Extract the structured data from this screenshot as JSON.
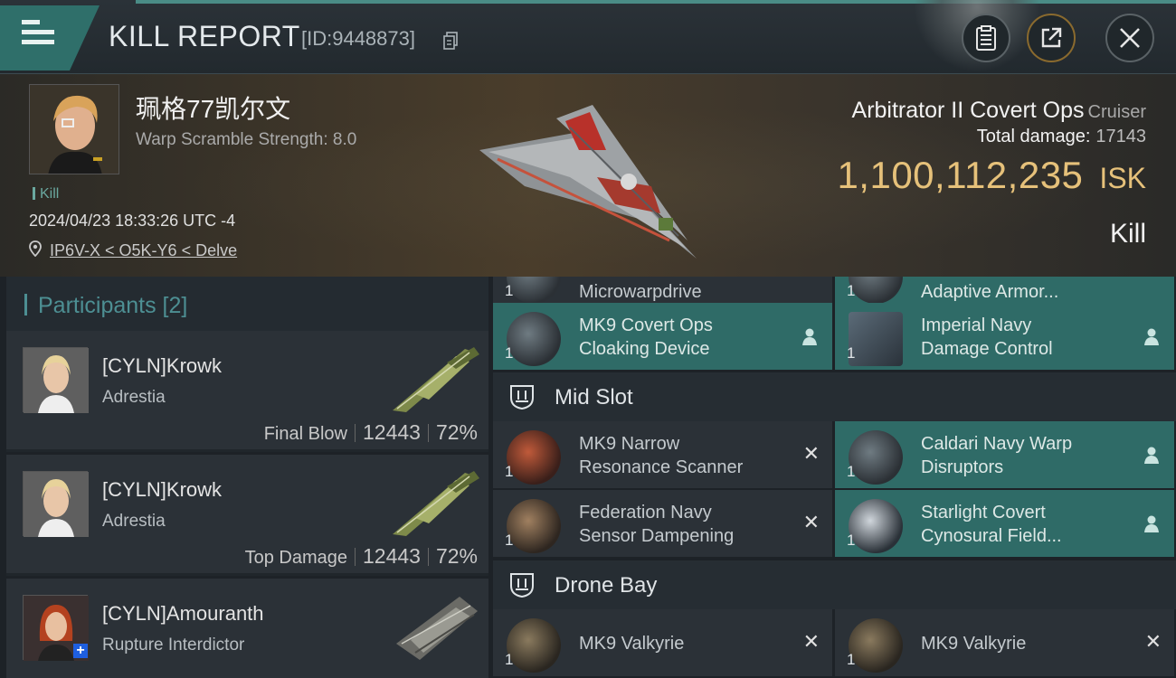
{
  "header": {
    "title": "KILL REPORT",
    "kill_id": "[ID:9448873]"
  },
  "icons": {
    "menu": "hamburger-menu-icon",
    "copy": "copy-icon",
    "report": "clipboard-icon",
    "share": "share-external-icon",
    "close": "close-icon"
  },
  "victim": {
    "name": "珮格77凯尔文",
    "scram": "Warp Scramble Strength: 8.0",
    "tag": "Kill",
    "time": "2024/04/23 18:33:26 UTC -4",
    "location": "IP6V-X < O5K-Y6 < Delve"
  },
  "ship": {
    "name": "Arbitrator II Covert Ops",
    "class": "Cruiser",
    "damage_label": "Total damage:",
    "damage_value": "17143",
    "isk_value": "1,100,112,235",
    "isk_unit": "ISK",
    "result": "Kill"
  },
  "participants": {
    "title": "Participants [2]",
    "items": [
      {
        "name": "[CYLN]Krowk",
        "ship": "Adrestia",
        "role": "Final Blow",
        "damage": "12443",
        "percent": "72%"
      },
      {
        "name": "[CYLN]Krowk",
        "ship": "Adrestia",
        "role": "Top Damage",
        "damage": "12443",
        "percent": "72%"
      },
      {
        "name": "[CYLN]Amouranth",
        "ship": "Rupture Interdictor"
      }
    ]
  },
  "fitting": {
    "top_partial": [
      {
        "label": "Microwarpdrive",
        "qty": "1"
      },
      {
        "label": "Adaptive Armor...",
        "qty": "1"
      }
    ],
    "low_slots": [
      {
        "label_line1": "MK9 Covert Ops",
        "label_line2": "Cloaking Device",
        "qty": "1"
      },
      {
        "label_line1": "Imperial Navy",
        "label_line2": "Damage Control",
        "qty": "1"
      }
    ],
    "mid_slot_title": "Mid Slot",
    "mid_slots": [
      {
        "label_line1": "MK9 Narrow",
        "label_line2": "Resonance Scanner",
        "qty": "1",
        "status": "destroyed"
      },
      {
        "label_line1": "Caldari Navy Warp",
        "label_line2": "Disruptors",
        "qty": "1",
        "status": "dropped"
      },
      {
        "label_line1": "Federation Navy",
        "label_line2": "Sensor Dampening",
        "qty": "1",
        "status": "destroyed"
      },
      {
        "label_line1": "Starlight Covert",
        "label_line2": "Cynosural Field...",
        "qty": "1",
        "status": "dropped"
      }
    ],
    "drone_bay_title": "Drone Bay",
    "drones": [
      {
        "label": "MK9  Valkyrie",
        "qty": "1"
      },
      {
        "label": "MK9  Valkyrie",
        "qty": "1"
      }
    ],
    "destroyed_mark": "✕"
  },
  "colors": {
    "accent_teal": "#2f6b67",
    "isk_gold": "#e6c17a",
    "participant_title": "#4d8f93"
  }
}
